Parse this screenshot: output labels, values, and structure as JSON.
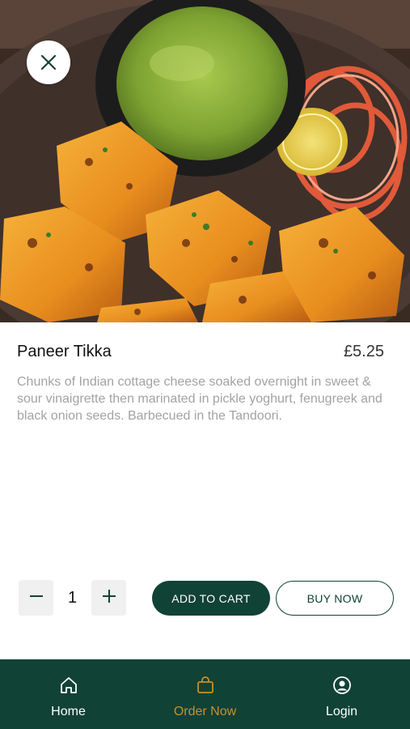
{
  "item": {
    "name": "Paneer Tikka",
    "price": "£5.25",
    "description": "Chunks of Indian cottage cheese soaked overnight in sweet & sour vinaigrette then marinated in pickle yoghurt, fenugreek and black onion seeds. Barbecued in the Tandoori."
  },
  "quantity": {
    "value": "1",
    "decrement_icon": "minus-icon",
    "increment_icon": "plus-icon"
  },
  "actions": {
    "add_to_cart": "ADD TO CART",
    "buy_now": "BUY NOW"
  },
  "nav": {
    "items": [
      {
        "label": "Home",
        "icon": "home-icon"
      },
      {
        "label": "Order Now",
        "icon": "shopping-bag-icon",
        "active": true
      },
      {
        "label": "Login",
        "icon": "user-circle-icon"
      }
    ]
  },
  "colors": {
    "brand": "#114236",
    "accent": "#c98f2a",
    "muted_text": "#a3a3a3"
  }
}
